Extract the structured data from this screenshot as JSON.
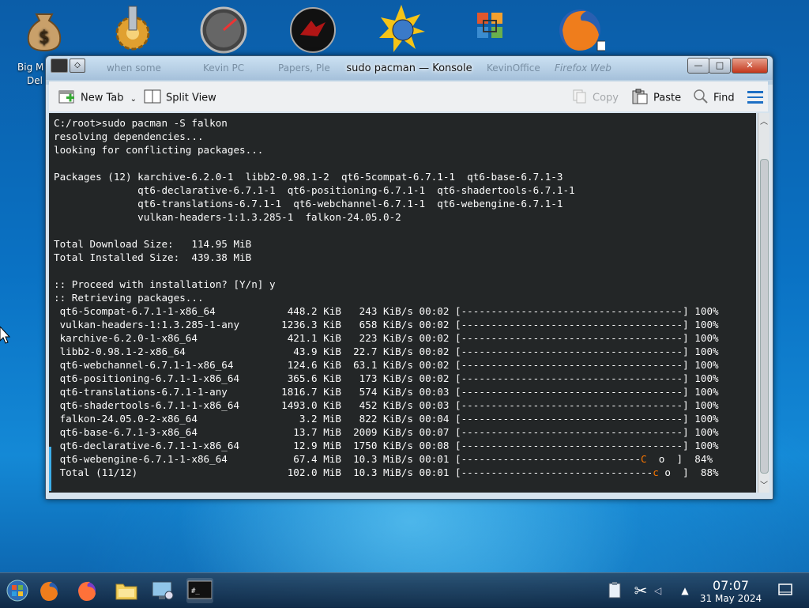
{
  "desktop": {
    "icons": [
      {
        "label": "Big Mo...\nDel...",
        "label_line1": "Big M",
        "label_line2": "Del"
      },
      {
        "label": "when some"
      },
      {
        "label": "Kevin PC"
      },
      {
        "label": "Papers, Please"
      },
      {
        "label": ""
      },
      {
        "label": "KevinOffice"
      },
      {
        "label": "Firefox Web"
      }
    ]
  },
  "window": {
    "title": "sudo pacman — Konsole",
    "ghost_labels": [
      "when some",
      "Kevin PC",
      "Papers, Ple",
      "KevinOffice",
      "Firefox Web"
    ],
    "controls": {
      "minimize": "—",
      "maximize": "□",
      "close": "✕"
    }
  },
  "toolbar": {
    "new_tab": "New Tab",
    "split_view": "Split View",
    "copy": "Copy",
    "paste": "Paste",
    "find": "Find"
  },
  "terminal": {
    "lines": [
      "C:/root>sudo pacman -S falkon",
      "resolving dependencies...",
      "looking for conflicting packages...",
      "",
      "Packages (12) karchive-6.2.0-1  libb2-0.98.1-2  qt6-5compat-6.7.1-1  qt6-base-6.7.1-3",
      "              qt6-declarative-6.7.1-1  qt6-positioning-6.7.1-1  qt6-shadertools-6.7.1-1",
      "              qt6-translations-6.7.1-1  qt6-webchannel-6.7.1-1  qt6-webengine-6.7.1-1",
      "              vulkan-headers-1:1.3.285-1  falkon-24.05.0-2",
      "",
      "Total Download Size:   114.95 MiB",
      "Total Installed Size:  439.38 MiB",
      "",
      ":: Proceed with installation? [Y/n] y",
      ":: Retrieving packages...",
      " qt6-5compat-6.7.1-1-x86_64            448.2 KiB   243 KiB/s 00:02 [-------------------------------------] 100%",
      " vulkan-headers-1:1.3.285-1-any       1236.3 KiB   658 KiB/s 00:02 [-------------------------------------] 100%",
      " karchive-6.2.0-1-x86_64               421.1 KiB   223 KiB/s 00:02 [-------------------------------------] 100%",
      " libb2-0.98.1-2-x86_64                  43.9 KiB  22.7 KiB/s 00:02 [-------------------------------------] 100%",
      " qt6-webchannel-6.7.1-1-x86_64         124.6 KiB  63.1 KiB/s 00:02 [-------------------------------------] 100%",
      " qt6-positioning-6.7.1-1-x86_64        365.6 KiB   173 KiB/s 00:02 [-------------------------------------] 100%",
      " qt6-translations-6.7.1-1-any         1816.7 KiB   574 KiB/s 00:03 [-------------------------------------] 100%",
      " qt6-shadertools-6.7.1-1-x86_64       1493.0 KiB   452 KiB/s 00:03 [-------------------------------------] 100%",
      " falkon-24.05.0-2-x86_64                 3.2 MiB   822 KiB/s 00:04 [-------------------------------------] 100%",
      " qt6-base-6.7.1-3-x86_64                13.7 MiB  2009 KiB/s 00:07 [-------------------------------------] 100%",
      " qt6-declarative-6.7.1-1-x86_64         12.9 MiB  1750 KiB/s 00:08 [-------------------------------------] 100%"
    ],
    "progress_lines": [
      {
        "prefix": " qt6-webengine-6.7.1-1-x86_64           67.4 MiB  10.3 MiB/s 00:01 [------------------------------",
        "pac": "C",
        "suffix": "  o  ]  84%"
      },
      {
        "prefix": " Total (11/12)                         102.0 MiB  10.3 MiB/s 00:01 [--------------------------------",
        "pac": "c",
        "suffix": " o  ]  88%"
      }
    ]
  },
  "taskbar": {
    "clock_time": "07:07",
    "clock_date": "31 May 2024"
  },
  "colors": {
    "terminal_bg": "#232627",
    "terminal_fg": "#fcfcfc",
    "pacman_accent": "#f67400"
  }
}
